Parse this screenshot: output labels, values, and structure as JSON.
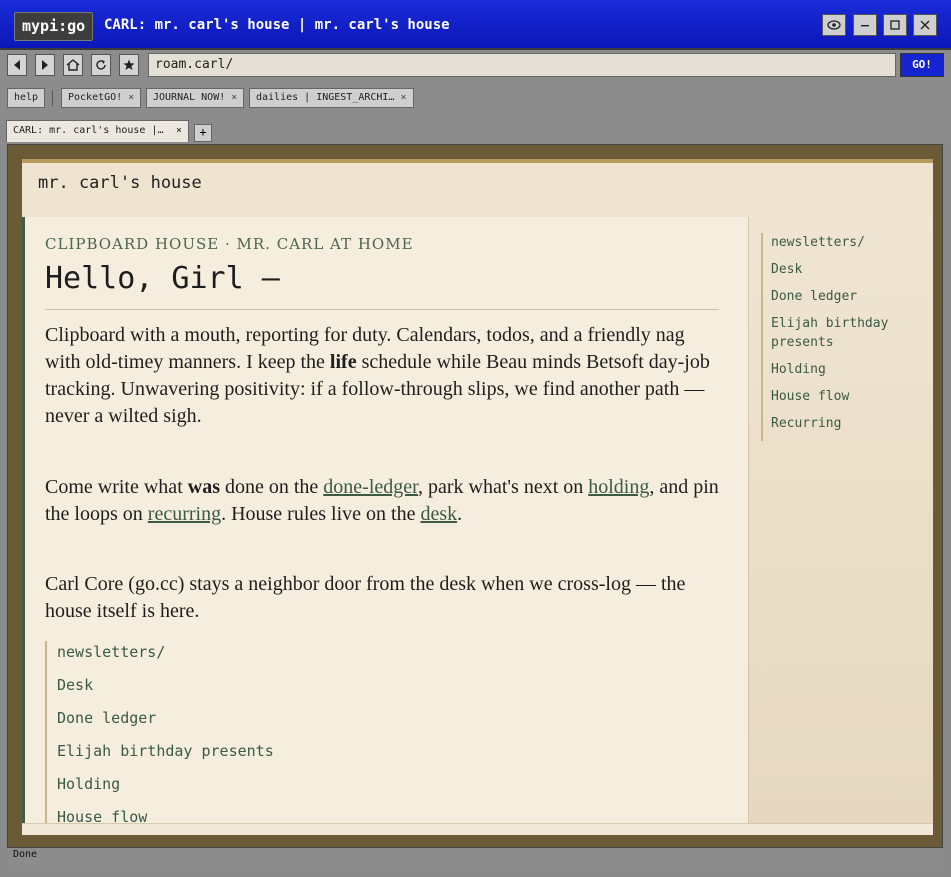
{
  "window": {
    "app_badge": "mypi:go",
    "title": "CARL: mr. carl's house | mr. carl's house"
  },
  "toolbar": {
    "url": "roam.carl/",
    "go_label": "GO!"
  },
  "bookmarks": {
    "help_label": "help",
    "items": [
      {
        "label": "PocketGO!"
      },
      {
        "label": "JOURNAL NOW!"
      },
      {
        "label": "dailies | INGEST_ARCHI…"
      }
    ]
  },
  "tabs": {
    "active_label": "CARL: mr. carl's house |…",
    "new_tab_label": "+"
  },
  "page": {
    "header_title": "mr. carl's house",
    "kicker": "CLIPBOARD HOUSE · MR. CARL AT HOME",
    "heading": "Hello, Girl —",
    "intro_before": "Clipboard with a mouth, reporting for duty. Calendars, todos, and a friendly nag with old-timey manners. I keep the ",
    "intro_bold": "life",
    "intro_after": " schedule while Beau minds Betsoft day-job tracking. Unwavering positivity: if a follow-through slips, we find another path — never a wilted sigh.",
    "p2_a": "Come write what ",
    "p2_bold": "was",
    "p2_b": " done on the ",
    "p2_link1": "done-ledger",
    "p2_c": ", park what's next on ",
    "p2_link2": "holding",
    "p2_d": ", and pin the loops on ",
    "p2_link3": "recurring",
    "p2_e": ". House rules live on the ",
    "p2_link4": "desk",
    "p2_f": ".",
    "p3": "Carl Core (go.cc) stays a neighbor door from the desk when we cross-log — the house itself is here.",
    "links": [
      "newsletters/",
      "Desk",
      "Done ledger",
      "Elijah birthday presents",
      "Holding",
      "House flow"
    ]
  },
  "sidebar": {
    "items": [
      "newsletters/",
      "Desk",
      "Done ledger",
      "Elijah birthday presents",
      "Holding",
      "House flow",
      "Recurring"
    ]
  },
  "status": {
    "text": "Done"
  }
}
